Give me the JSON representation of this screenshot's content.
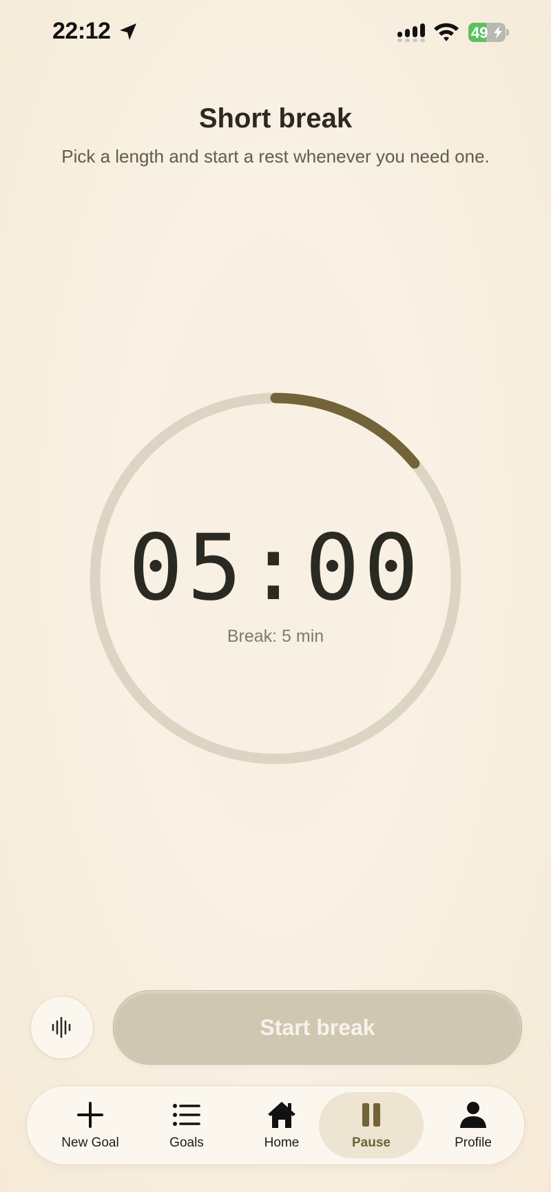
{
  "status_bar": {
    "time": "22:12",
    "battery": "49",
    "battery_level": 0.49,
    "icons": [
      "location-arrow-icon",
      "cellular-signal-icon",
      "wifi-icon",
      "battery-charging-icon"
    ]
  },
  "header": {
    "title": "Short break",
    "subtitle": "Pick a length and start a rest whenever you need one."
  },
  "timer": {
    "display": "05:00",
    "label": "Break: 5 min",
    "progress": 0.14,
    "progress_color": "#736338",
    "track_color": "#ddd5c3"
  },
  "controls": {
    "sound_button_icon": "sound-wave-icon",
    "start_button_label": "Start break"
  },
  "tab_bar": {
    "active": "Pause",
    "tabs": [
      {
        "label": "New Goal",
        "icon": "plus-icon"
      },
      {
        "label": "Goals",
        "icon": "list-icon"
      },
      {
        "label": "Home",
        "icon": "home-icon"
      },
      {
        "label": "Pause",
        "icon": "pause-icon"
      },
      {
        "label": "Profile",
        "icon": "person-icon"
      }
    ]
  },
  "colors": {
    "accent": "#736338",
    "background": "#f7efe2",
    "button_disabled": "#d0c7b3"
  }
}
